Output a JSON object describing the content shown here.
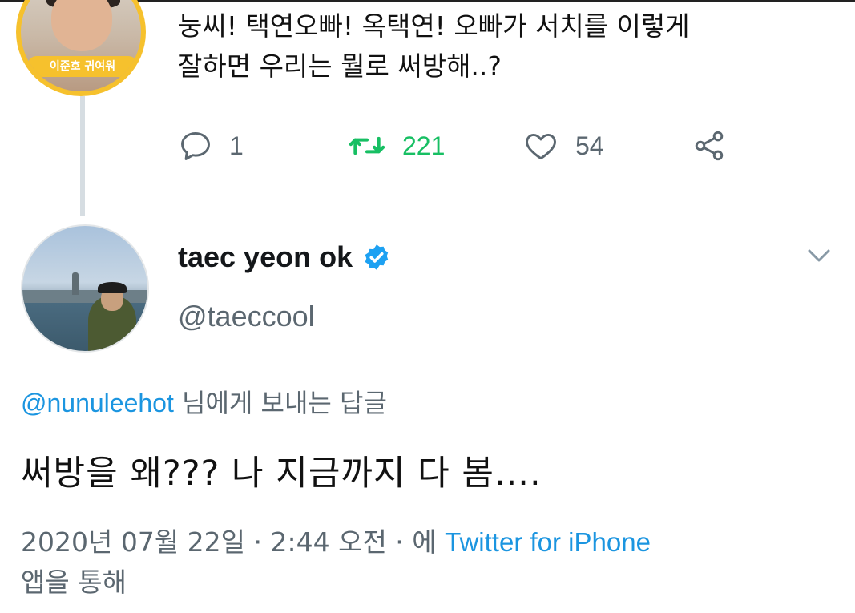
{
  "parent_tweet": {
    "avatar_badge": "이준호 귀여워",
    "text_line1": "눙씨! 택연오빠! 옥택연! 오빠가 서치를 이렇게",
    "text_line2": "잘하면 우리는 뭘로 써방해..?",
    "actions": {
      "reply_count": "1",
      "retweet_count": "221",
      "like_count": "54"
    },
    "colors": {
      "retweet_active": "#17bf63",
      "icon_gray": "#5b6770"
    }
  },
  "reply_tweet": {
    "display_name": "taec yeon ok",
    "handle": "@taeccool",
    "replying_to_mention": "@nunuleehot",
    "replying_to_suffix": " 님에게 보내는 답글",
    "text": "써방을 왜??? 나 지금까지 다 봄....",
    "meta_prefix": "2020년 07월 22일 · 2:44 오전 · 에 ",
    "meta_source": "Twitter for iPhone",
    "meta_suffix": "앱을 통해",
    "colors": {
      "link": "#1b95e0",
      "verified": "#1da1f2"
    }
  },
  "icons": [
    "reply-icon",
    "retweet-icon",
    "like-icon",
    "share-icon",
    "verified-badge-icon",
    "chevron-down-icon"
  ]
}
